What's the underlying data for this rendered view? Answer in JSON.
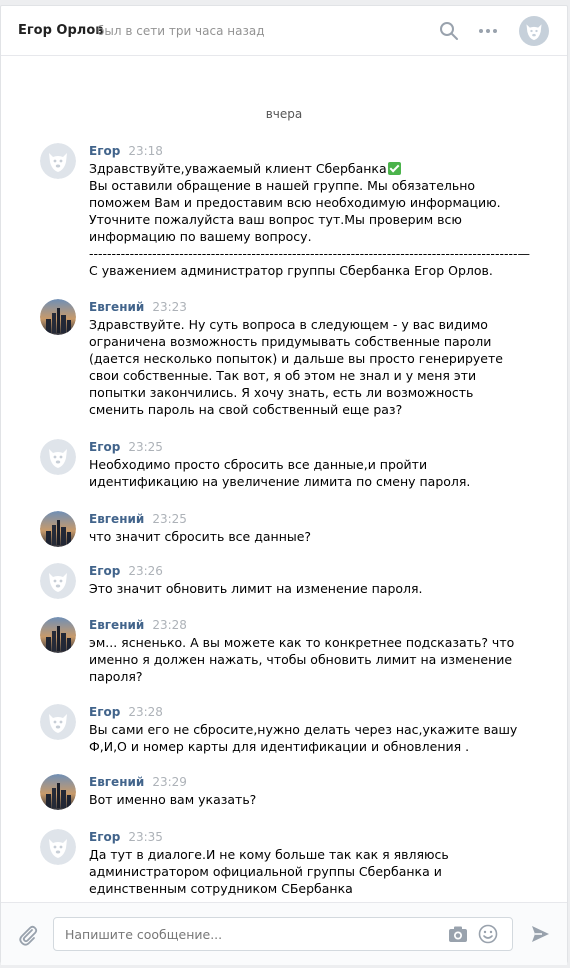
{
  "header": {
    "name": "Егор Орлов",
    "status": "был в сети три часа назад"
  },
  "date_separator": "вчера",
  "messages": [
    {
      "author": "Егор",
      "time": "23:18",
      "avatar": "dog-avatar",
      "lines": [
        "Здравствуйте,уважаемый клиент Сбербанка",
        "Вы оставили обращение в нашей группе. Мы обязательно",
        "поможем Вам и предоставим всю необходимую информацию.",
        "Уточните пожалуйста ваш вопрос тут.Мы проверим всю",
        "информацию по вашему вопросу.",
        "-----------------------------------------------------------------------------------------------—",
        "С уважением администратор группы Сбербанка Егор Орлов."
      ]
    },
    {
      "author": "Евгений",
      "time": "23:23",
      "avatar": "city-avatar",
      "lines": [
        "Здравствуйте. Ну суть вопроса в следующем - у вас видимо",
        "ограничена возможность придумывать собственные пароли",
        "(дается несколько попыток) и дальше вы просто генерируете",
        "свои собственные. Так вот, я об этом не знал и у меня эти",
        "попытки закончились. Я хочу знать, есть ли возможность",
        "сменить пароль на свой собственный еще раз?"
      ]
    },
    {
      "author": "Егор",
      "time": "23:25",
      "avatar": "dog-avatar",
      "lines": [
        "Необходимо просто сбросить все данные,и пройти",
        "идентификацию на увеличение лимита по смену пароля."
      ]
    },
    {
      "author": "Евгений",
      "time": "23:25",
      "avatar": "city-avatar",
      "lines": [
        "что значит сбросить все данные?"
      ]
    },
    {
      "author": "Егор",
      "time": "23:26",
      "avatar": "dog-avatar",
      "lines": [
        "Это значит обновить лимит на изменение пароля."
      ]
    },
    {
      "author": "Евгений",
      "time": "23:28",
      "avatar": "city-avatar",
      "lines": [
        "эм... ясненько. А вы можете как то конкретнее подсказать? что",
        "именно я должен нажать, чтобы обновить лимит на изменение",
        "пароля?"
      ]
    },
    {
      "author": "Егор",
      "time": "23:28",
      "avatar": "dog-avatar",
      "lines": [
        "Вы сами его не сбросите,нужно делать через нас,укажите вашу",
        "Ф,И,О и номер карты для идентификации и обновления ."
      ]
    },
    {
      "author": "Евгений",
      "time": "23:29",
      "avatar": "city-avatar",
      "lines": [
        "Вот именно вам указать?"
      ]
    },
    {
      "author": "Егор",
      "time": "23:35",
      "avatar": "dog-avatar",
      "lines": [
        "Да тут в диалоге.И не кому больше так как я являюсь",
        "администратором официальной группы Сбербанка и",
        "единственным сотрудником СБербанка"
      ]
    }
  ],
  "composer": {
    "placeholder": "Напишите сообщение..."
  },
  "colors": {
    "author": "#42648b",
    "time": "#adb2b8",
    "checkmark": "#4bb34b",
    "background": "#edeef0"
  }
}
